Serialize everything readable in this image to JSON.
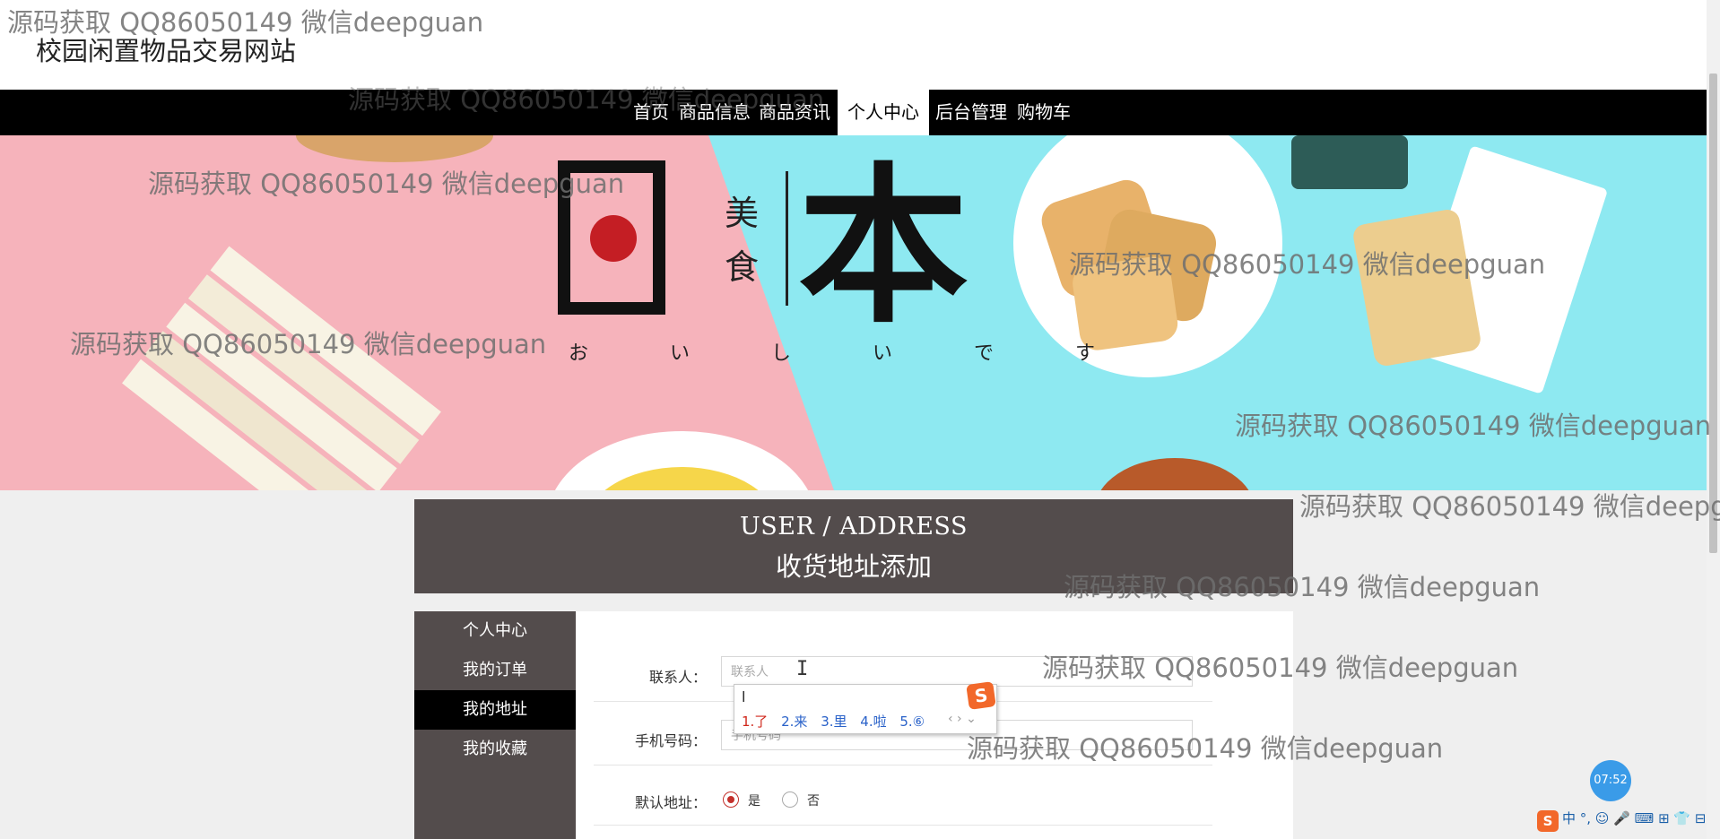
{
  "site": {
    "title": "校园闲置物品交易网站"
  },
  "nav": [
    {
      "label": "首页"
    },
    {
      "label": "商品信息"
    },
    {
      "label": "商品资讯"
    },
    {
      "label": "个人中心"
    },
    {
      "label": "后台管理"
    },
    {
      "label": "购物车"
    }
  ],
  "nav_active": "个人中心",
  "banner": {
    "big_char_1": "日",
    "small_char_1": "美",
    "small_char_2": "食",
    "big_char_2": "本",
    "subtitle": "お い し い で す"
  },
  "title_box": {
    "en": "USER / ADDRESS",
    "zh": "收货地址添加"
  },
  "side_menu": [
    {
      "label": "个人中心"
    },
    {
      "label": "我的订单"
    },
    {
      "label": "我的地址"
    },
    {
      "label": "我的收藏"
    }
  ],
  "side_menu_active": "我的地址",
  "form": {
    "contact_label": "联系人：",
    "contact_placeholder": "联系人",
    "phone_label": "手机号码：",
    "phone_placeholder": "手机号码",
    "default_label": "默认地址：",
    "yes_label": "是",
    "no_label": "否",
    "default_selected": "是"
  },
  "ime": {
    "composition": "l",
    "candidates": [
      "1.了",
      "2.来",
      "3.里",
      "4.啦",
      "5.⑥"
    ],
    "arrows": "‹ › ⌄",
    "logo": "S"
  },
  "clock": "07:52",
  "taskbar": {
    "logo": "S",
    "items": "中 °, ☺ 🎤 ⌨ ⊞ 👕 ⊟"
  },
  "watermark": "源码获取 QQ86050149 微信deepguan",
  "colors": {
    "nav_bg": "#000000",
    "panel_bg": "#534c4c",
    "banner_pink": "#f6b3bb",
    "banner_cyan": "#8ee9f1",
    "radio_accent": "#c3302b",
    "clock_bg": "#3a9be8"
  }
}
